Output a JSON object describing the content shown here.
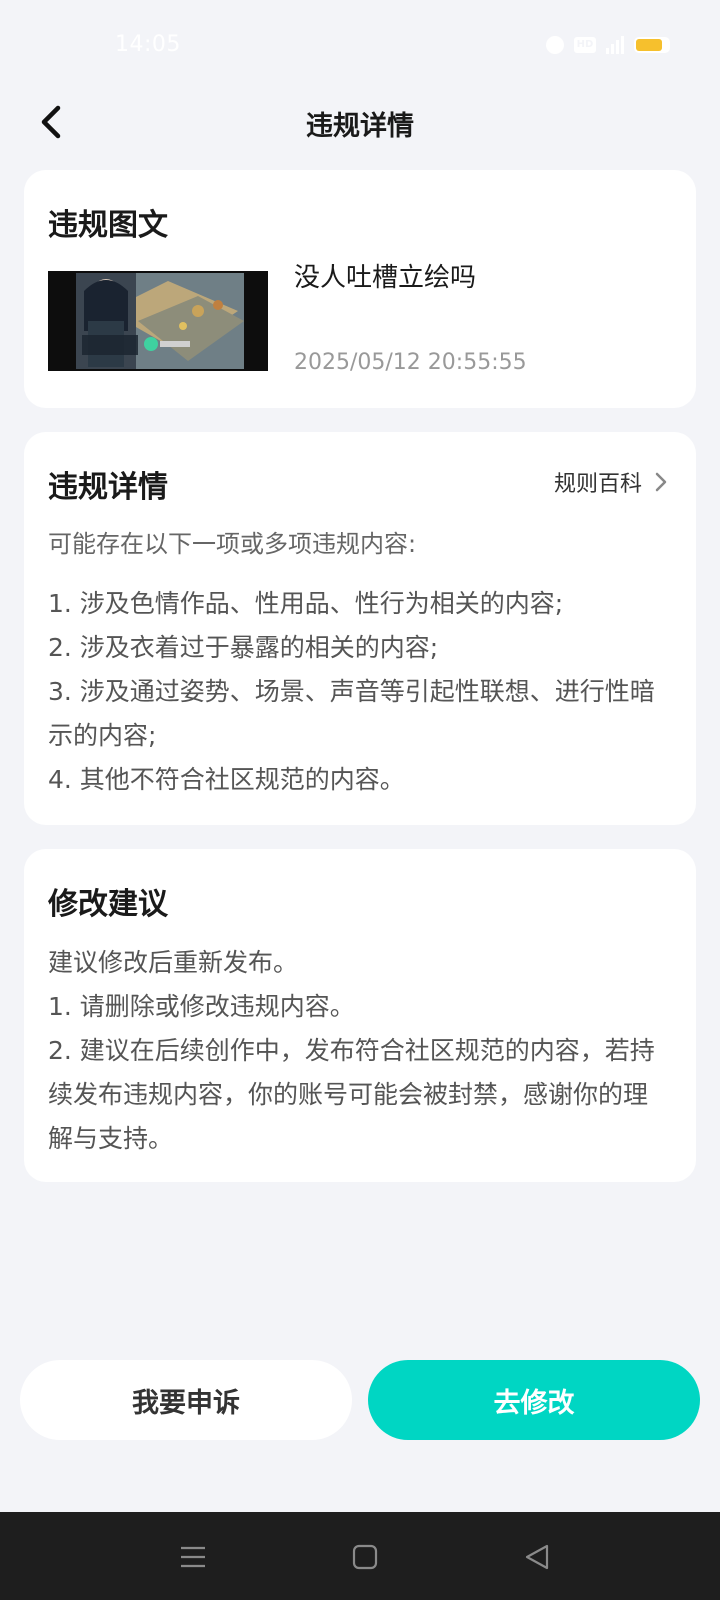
{
  "status_bar": {
    "time": "14:05",
    "icons": [
      "alarm-icon",
      "hd-icon",
      "signal-icon",
      "battery-icon"
    ],
    "hd_label": "HD",
    "battery_color": "#f6c02d"
  },
  "nav": {
    "title": "违规详情",
    "back_icon": "chevron-left-icon"
  },
  "post_card": {
    "title": "违规图文",
    "post_title": "没人吐槽立绘吗",
    "post_time": "2025/05/12 20:55:55"
  },
  "detail_card": {
    "title": "违规详情",
    "rules_link": "规则百科",
    "intro": "可能存在以下一项或多项违规内容:",
    "items": [
      "1. 涉及色情作品、性用品、性行为相关的内容;",
      "2. 涉及衣着过于暴露的相关的内容;",
      "3. 涉及通过姿势、场景、声音等引起性联想、进行性暗示的内容;",
      "4. 其他不符合社区规范的内容。"
    ]
  },
  "suggest_card": {
    "title": "修改建议",
    "lines": [
      "建议修改后重新发布。",
      "1. 请删除或修改违规内容。",
      "2. 建议在后续创作中，发布符合社区规范的内容，若持续发布违规内容，你的账号可能会被封禁，感谢你的理解与支持。"
    ]
  },
  "actions": {
    "appeal": "我要申诉",
    "edit": "去修改",
    "accent": "#00d6c3"
  },
  "system_nav": {
    "icons": [
      "menu-icon",
      "home-icon",
      "back-triangle-icon"
    ]
  }
}
